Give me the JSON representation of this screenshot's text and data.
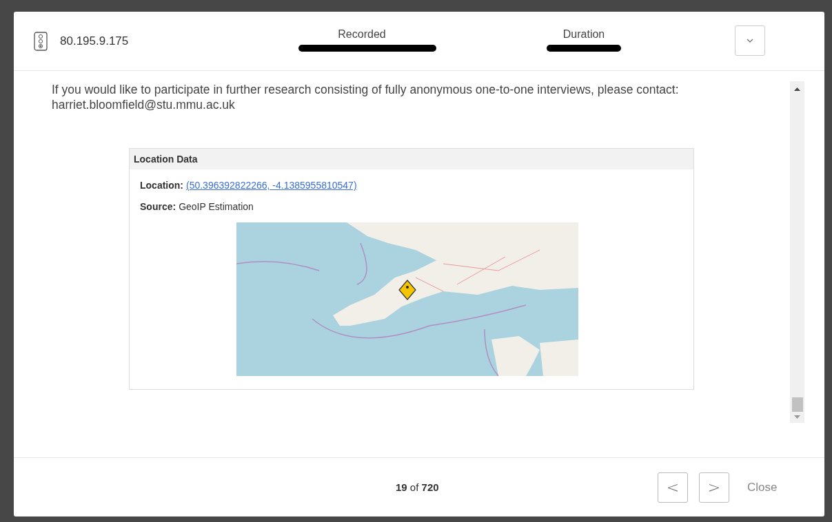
{
  "header": {
    "ip": "80.195.9.175",
    "fields": [
      {
        "label": "Recorded",
        "redacted": true
      },
      {
        "label": "Duration",
        "redacted": true
      }
    ]
  },
  "message": "If you would like to participate in further research consisting of fully anonymous one-to-one interviews, please contact: harriet.bloomfield@stu.mmu.ac.uk",
  "location_panel": {
    "title": "Location Data",
    "rows": [
      {
        "label": "Location:",
        "value": "(50.396392822266, -4.1385955810547)",
        "kind": "link"
      },
      {
        "label": "Source:",
        "value": "GeoIP Estimation",
        "kind": "text"
      }
    ]
  },
  "footer": {
    "current": "19",
    "separator": "of",
    "total": "720",
    "prev": "<",
    "next": ">",
    "close": "Close"
  }
}
